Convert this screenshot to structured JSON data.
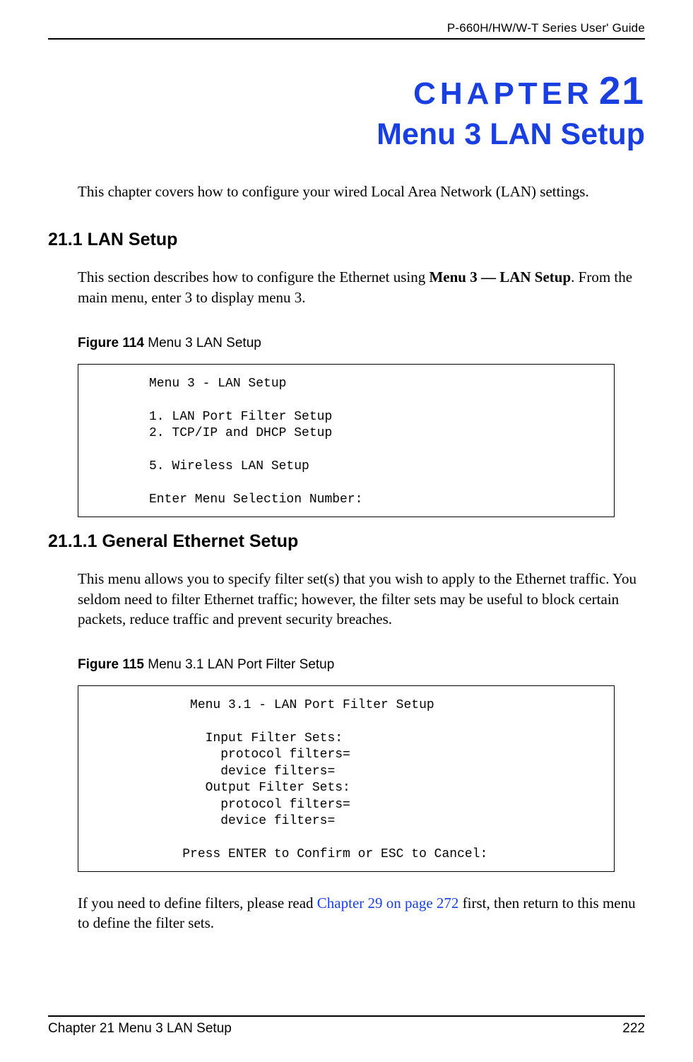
{
  "header": {
    "guide_title": "P-660H/HW/W-T Series User' Guide"
  },
  "chapter": {
    "label": "CHAPTER",
    "number": "21",
    "title": "Menu 3 LAN Setup",
    "intro": "This chapter covers how to configure your wired Local Area Network (LAN) settings."
  },
  "section_21_1": {
    "heading": "21.1  LAN Setup",
    "body_pre": "This section describes how to configure the Ethernet using ",
    "body_bold": "Menu 3 — LAN Setup",
    "body_post": ". From the main menu, enter 3 to display menu 3."
  },
  "figure_114": {
    "label": "Figure 114",
    "caption": "   Menu 3 LAN Setup",
    "terminal": "Menu 3 - LAN Setup\n\n1. LAN Port Filter Setup\n2. TCP/IP and DHCP Setup\n\n5. Wireless LAN Setup\n\nEnter Menu Selection Number:"
  },
  "section_21_1_1": {
    "heading": "21.1.1  General Ethernet Setup",
    "body": "This menu allows you to specify filter set(s) that you wish to apply to the Ethernet traffic.  You seldom need to filter Ethernet traffic; however, the filter sets may be useful to block certain packets, reduce traffic and prevent security breaches."
  },
  "figure_115": {
    "label": "Figure 115",
    "caption": "   Menu 3.1 LAN Port Filter Setup",
    "terminal": "          Menu 3.1 - LAN Port Filter Setup\n\n            Input Filter Sets:\n              protocol filters=\n              device filters=\n            Output Filter Sets:\n              protocol filters=\n              device filters=\n\n         Press ENTER to Confirm or ESC to Cancel:"
  },
  "closing": {
    "pre": "If you need to define filters, please read ",
    "link": "Chapter 29 on page 272",
    "post": " first, then return to this menu to define the filter sets."
  },
  "footer": {
    "left": "Chapter 21 Menu 3 LAN Setup",
    "right": "222"
  }
}
